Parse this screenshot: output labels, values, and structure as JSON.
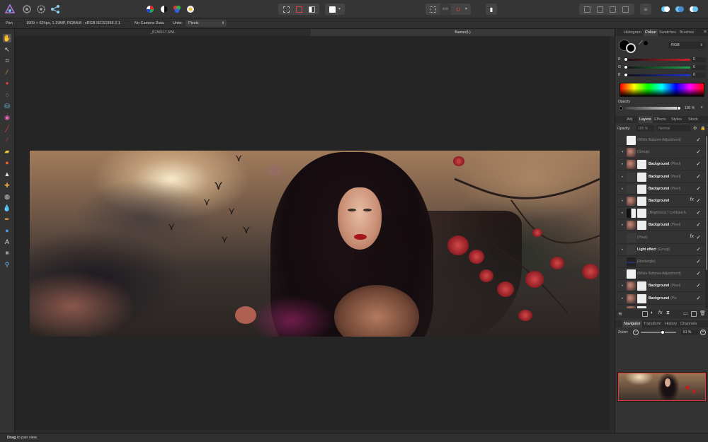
{
  "context": {
    "tool": "Pan",
    "doc_info": "1909 × 624px, 1.19MP, RGBA/8 - sRGB IEC61966-2.1",
    "camera": "No Camera Data",
    "units_label": "Units:",
    "units_value": "Pixels"
  },
  "doc_tabs": [
    {
      "label": "_B7A0117.SWL"
    },
    {
      "label": "Banner(L)"
    }
  ],
  "colour_panel": {
    "tabs": [
      "Histogram",
      "Colour",
      "Swatches",
      "Brushes"
    ],
    "active_tab": "Colour",
    "model": "RGB",
    "channels": [
      {
        "label": "R",
        "value": "0",
        "color": "#d0202a"
      },
      {
        "label": "G",
        "value": "0",
        "color": "#1fa24a"
      },
      {
        "label": "B",
        "value": "0",
        "color": "#2032c8"
      }
    ],
    "opacity_label": "Opacity",
    "opacity_value": "100 %"
  },
  "layers_panel": {
    "tabs": [
      "Adj",
      "Layers",
      "Effects",
      "Styles",
      "Stock"
    ],
    "active_tab": "Layers",
    "opacity_label": "Opacity:",
    "opacity_value": "100 %",
    "blend_mode": "Normal",
    "layers": [
      {
        "name": "(White Balance Adjustment)",
        "dim": true,
        "thumb": "white",
        "mask": false,
        "fx": false,
        "arrow": ""
      },
      {
        "name": "(Group)",
        "dim": true,
        "thumb": "img",
        "mask": false,
        "fx": false,
        "arrow": "▾"
      },
      {
        "name": "Background",
        "suffix": "(Pixel)",
        "dim": false,
        "thumb": "img",
        "mask": true,
        "fx": false,
        "arrow": "▸"
      },
      {
        "name": "Background",
        "suffix": "(Pixel)",
        "dim": false,
        "thumb": "dark",
        "mask": true,
        "fx": false,
        "arrow": "▸"
      },
      {
        "name": "Background",
        "suffix": "(Pixel)",
        "dim": false,
        "thumb": "dark",
        "mask": true,
        "fx": false,
        "arrow": "▸"
      },
      {
        "name": "Background",
        "suffix": "",
        "dim": false,
        "thumb": "img",
        "mask": true,
        "fx": true,
        "arrow": "▸"
      },
      {
        "name": "(Brightness / Contrast A",
        "dim": true,
        "thumb": "bw",
        "mask": true,
        "fx": false,
        "arrow": "▸"
      },
      {
        "name": "Background",
        "suffix": "(Pixel)",
        "dim": false,
        "thumb": "img",
        "mask": true,
        "fx": false,
        "arrow": "▸"
      },
      {
        "name": "(Pixel)",
        "dim": true,
        "thumb": "dark",
        "mask": false,
        "fx": true,
        "arrow": ""
      },
      {
        "name": "Light effect",
        "suffix": "(Group)",
        "dim": false,
        "thumb": "dark",
        "mask": false,
        "fx": false,
        "arrow": "▸"
      },
      {
        "name": "(Rectangle)",
        "dim": true,
        "thumb": "rect",
        "mask": false,
        "fx": false,
        "arrow": ""
      },
      {
        "name": "(White Balance Adjustment)",
        "dim": true,
        "thumb": "white",
        "mask": false,
        "fx": false,
        "arrow": ""
      },
      {
        "name": "Background",
        "suffix": "(Pixel)",
        "dim": false,
        "thumb": "img",
        "mask": true,
        "fx": false,
        "arrow": "▸"
      },
      {
        "name": "Background",
        "suffix": "(Pix",
        "dim": false,
        "thumb": "img",
        "mask": true,
        "fx": false,
        "arrow": "▸"
      },
      {
        "name": "Background",
        "suffix": "(Pixel)",
        "dim": false,
        "thumb": "img",
        "mask": true,
        "fx": false,
        "arrow": "▸"
      }
    ]
  },
  "navigator_panel": {
    "tabs": [
      "Navigator",
      "Transform",
      "History",
      "Channels"
    ],
    "active_tab": "Navigator",
    "zoom_label": "Zoom:",
    "zoom_value": "61 %",
    "zoom_level": 0.61
  },
  "status": {
    "bold": "Drag",
    "text": " to pan view."
  }
}
